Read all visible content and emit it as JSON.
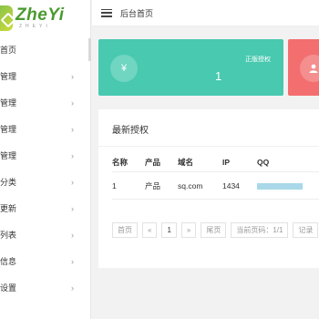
{
  "logo": {
    "title": "ZheYi",
    "subtitle": "ZHEYI"
  },
  "sidebar": {
    "items": [
      {
        "label": "首页",
        "has_chevron": false,
        "active": true
      },
      {
        "label": "管理",
        "has_chevron": true
      },
      {
        "label": "管理",
        "has_chevron": true
      },
      {
        "label": "管理",
        "has_chevron": true
      },
      {
        "label": "管理",
        "has_chevron": true
      },
      {
        "label": "分类",
        "has_chevron": true
      },
      {
        "label": "更新",
        "has_chevron": true
      },
      {
        "label": "列表",
        "has_chevron": true
      },
      {
        "label": "信息",
        "has_chevron": true
      },
      {
        "label": "设置",
        "has_chevron": true
      }
    ],
    "chevron": "›"
  },
  "header": {
    "breadcrumb": "后台首页"
  },
  "stats": {
    "green": {
      "icon": "¥",
      "label": "正版授权",
      "value": "1",
      "color": "#48c9b0"
    },
    "red": {
      "icon": "user-icon",
      "color": "#f36f6f"
    }
  },
  "panel": {
    "title": "最新授权",
    "columns": [
      "名称",
      "产品",
      "域名",
      "IP",
      "QQ"
    ],
    "rows": [
      {
        "name": "1",
        "product": "产品",
        "domain": "sq.com",
        "ip": "1434"
      }
    ]
  },
  "pager": {
    "first": "首页",
    "prev": "«",
    "page": "1",
    "next": "»",
    "last": "尾页",
    "current": "当前页码：1/1",
    "records": "记录"
  }
}
